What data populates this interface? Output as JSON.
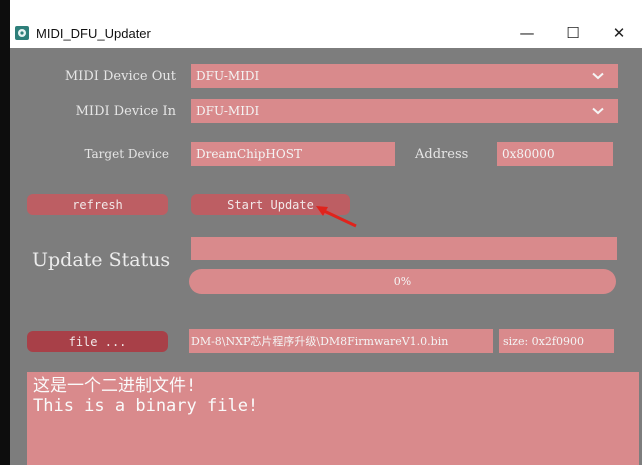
{
  "window": {
    "title": "MIDI_DFU_Updater",
    "minimize_glyph": "—",
    "maximize_glyph": "☐",
    "close_glyph": "✕",
    "app_icon": "midi-app-icon"
  },
  "form": {
    "midi_out_label": "MIDI Device Out",
    "midi_out_value": "DFU-MIDI",
    "midi_in_label": "MIDI Device In",
    "midi_in_value": "DFU-MIDI",
    "target_label": "Target Device",
    "target_value": "DreamChipHOST",
    "address_label": "Address",
    "address_value": "0x80000"
  },
  "buttons": {
    "refresh": "refresh",
    "start_update": "Start Update",
    "file": "file ..."
  },
  "status": {
    "label": "Update Status",
    "text": "",
    "progress_text": "0%",
    "progress_value": 0
  },
  "file_info": {
    "path": "DM-8\\NXP芯片程序升级\\DM8FirmwareV1.0.bin",
    "size": "size: 0x2f0900"
  },
  "output": {
    "line1": "这是一个二进制文件!",
    "line2": "This is a binary file!"
  },
  "colors": {
    "window_bg": "#7d7d7d",
    "field_pink": "#d98a8c",
    "button_red": "#bd5e63",
    "button_dark": "#a84048",
    "annotation_arrow": "#e0231c"
  }
}
